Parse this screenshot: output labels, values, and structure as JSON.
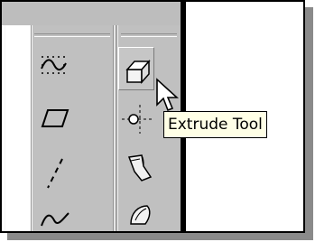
{
  "tooltip": {
    "text": "Extrude Tool"
  },
  "left_column_icons": [
    "spline-dotted-icon",
    "parallelogram-icon",
    "dashed-line-icon",
    "curve-icon"
  ],
  "right_column_icons": [
    "extrude-icon",
    "point-axis-icon",
    "sweep-icon",
    "revolve-icon"
  ],
  "colors": {
    "toolbar": "#c0c0c0",
    "tooltip_bg": "#ffffe6"
  }
}
